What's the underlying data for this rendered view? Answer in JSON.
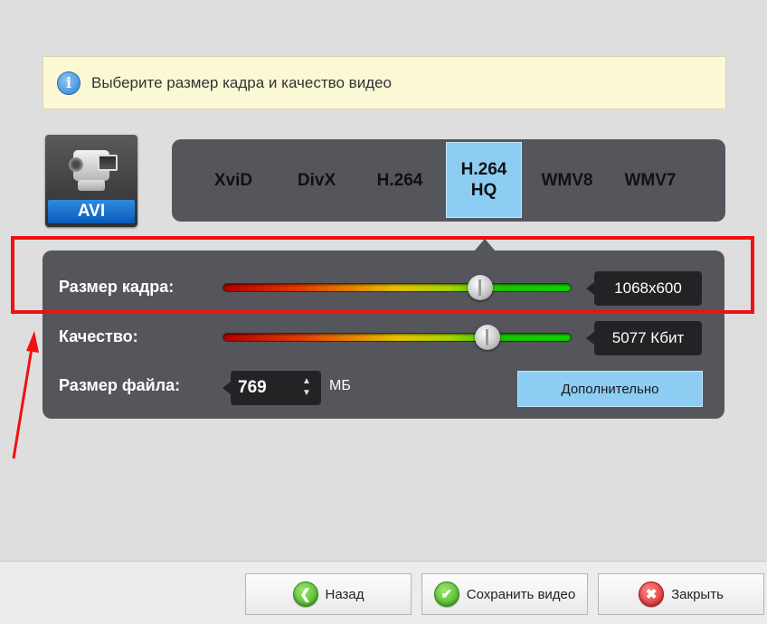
{
  "info": {
    "icon": "info-icon",
    "text": "Выберите размер кадра и качество видео"
  },
  "format": {
    "icon": "video-camera-icon",
    "label": "AVI"
  },
  "codecs": [
    {
      "label": "XviD",
      "active": false
    },
    {
      "label": "DivX",
      "active": false
    },
    {
      "label": "H.264",
      "active": false
    },
    {
      "label": "H.264\nHQ",
      "active": true
    },
    {
      "label": "WMV8",
      "active": false
    },
    {
      "label": "WMV7",
      "active": false
    }
  ],
  "settings": {
    "frame_size": {
      "label": "Размер кадра:",
      "value": "1068x600",
      "slider_level": 0.74
    },
    "quality": {
      "label": "Качество:",
      "value": "5077 Кбит",
      "slider_level": 0.76
    },
    "file_size": {
      "label": "Размер файла:",
      "value": "769",
      "unit": "МБ"
    },
    "advanced_label": "Дополнительно"
  },
  "buttons": {
    "back": {
      "label": "Назад",
      "icon": "arrow-left-icon"
    },
    "save": {
      "label": "Сохранить видео",
      "icon": "checkmark-icon"
    },
    "close": {
      "label": "Закрыть",
      "icon": "close-icon"
    }
  },
  "colors": {
    "panel": "#55565c",
    "active_tab": "#8ecdf3",
    "annotation": "#ee1111"
  }
}
